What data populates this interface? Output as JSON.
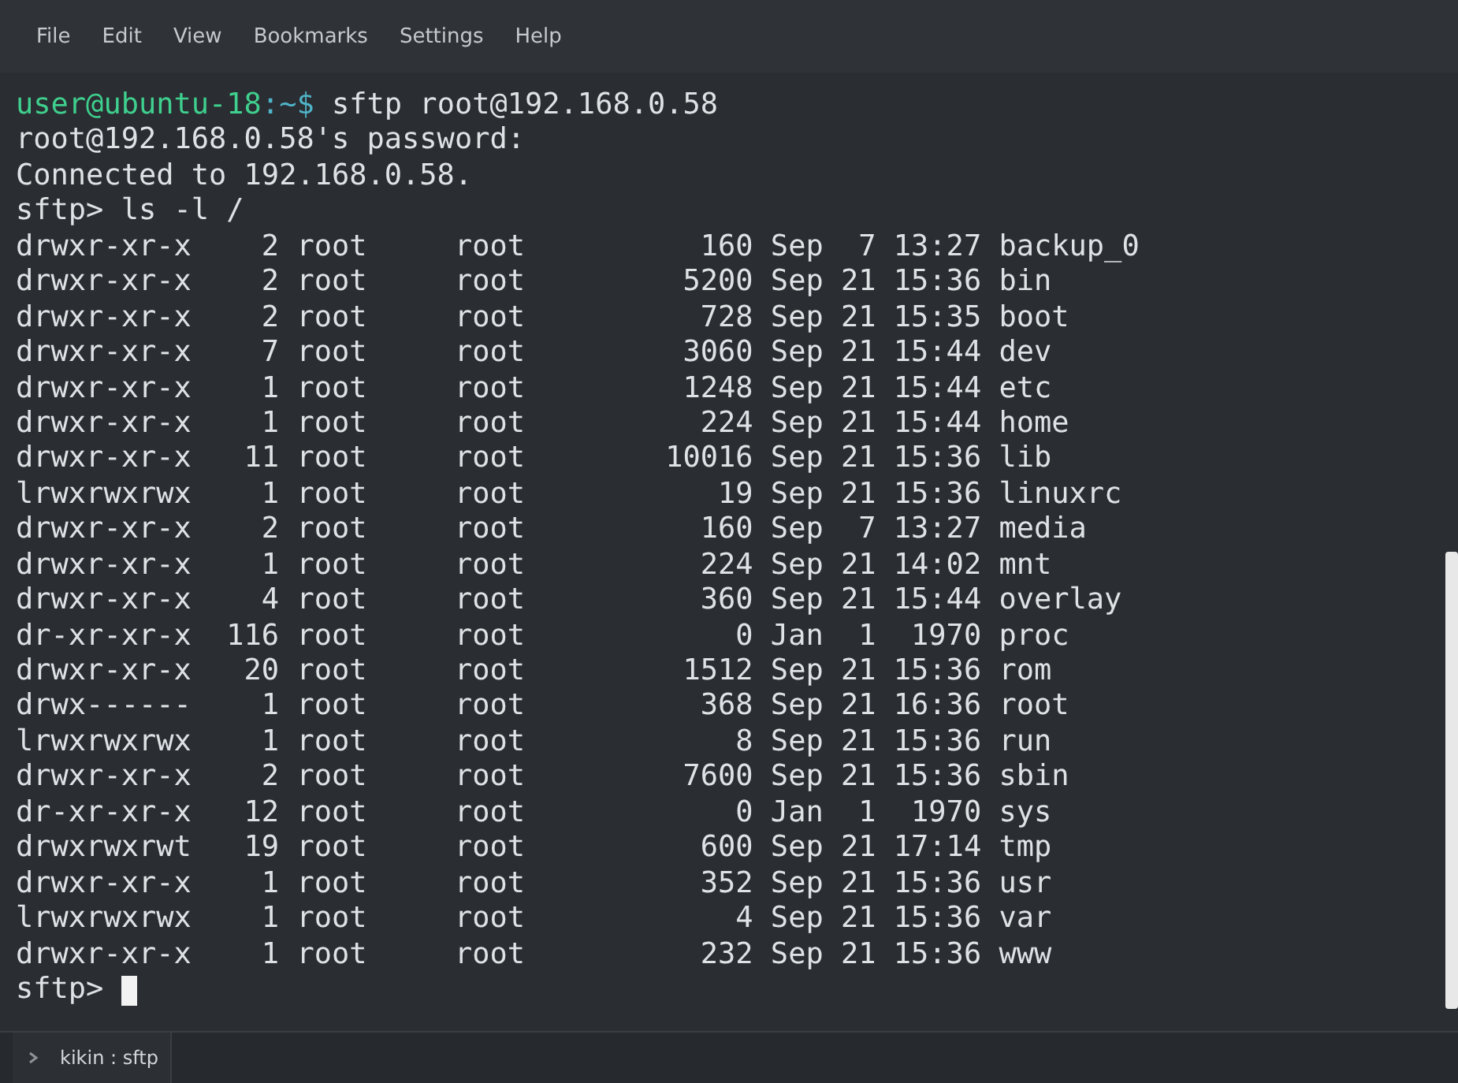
{
  "menu": [
    "File",
    "Edit",
    "View",
    "Bookmarks",
    "Settings",
    "Help"
  ],
  "terminal": {
    "lines": [
      {
        "kind": "prompt",
        "user_host": "user@ubuntu-18",
        "path": ":~$",
        "command": " sftp root@192.168.0.58"
      },
      {
        "kind": "text",
        "text": "root@192.168.0.58's password:"
      },
      {
        "kind": "text",
        "text": "Connected to 192.168.0.58."
      },
      {
        "kind": "text",
        "text": "sftp> ls -l /"
      },
      {
        "kind": "text",
        "text": "drwxr-xr-x    2 root     root          160 Sep  7 13:27 backup_0"
      },
      {
        "kind": "text",
        "text": "drwxr-xr-x    2 root     root         5200 Sep 21 15:36 bin"
      },
      {
        "kind": "text",
        "text": "drwxr-xr-x    2 root     root          728 Sep 21 15:35 boot"
      },
      {
        "kind": "text",
        "text": "drwxr-xr-x    7 root     root         3060 Sep 21 15:44 dev"
      },
      {
        "kind": "text",
        "text": "drwxr-xr-x    1 root     root         1248 Sep 21 15:44 etc"
      },
      {
        "kind": "text",
        "text": "drwxr-xr-x    1 root     root          224 Sep 21 15:44 home"
      },
      {
        "kind": "text",
        "text": "drwxr-xr-x   11 root     root        10016 Sep 21 15:36 lib"
      },
      {
        "kind": "text",
        "text": "lrwxrwxrwx    1 root     root           19 Sep 21 15:36 linuxrc"
      },
      {
        "kind": "text",
        "text": "drwxr-xr-x    2 root     root          160 Sep  7 13:27 media"
      },
      {
        "kind": "text",
        "text": "drwxr-xr-x    1 root     root          224 Sep 21 14:02 mnt"
      },
      {
        "kind": "text",
        "text": "drwxr-xr-x    4 root     root          360 Sep 21 15:44 overlay"
      },
      {
        "kind": "text",
        "text": "dr-xr-xr-x  116 root     root            0 Jan  1  1970 proc"
      },
      {
        "kind": "text",
        "text": "drwxr-xr-x   20 root     root         1512 Sep 21 15:36 rom"
      },
      {
        "kind": "text",
        "text": "drwx------    1 root     root          368 Sep 21 16:36 root"
      },
      {
        "kind": "text",
        "text": "lrwxrwxrwx    1 root     root            8 Sep 21 15:36 run"
      },
      {
        "kind": "text",
        "text": "drwxr-xr-x    2 root     root         7600 Sep 21 15:36 sbin"
      },
      {
        "kind": "text",
        "text": "dr-xr-xr-x   12 root     root            0 Jan  1  1970 sys"
      },
      {
        "kind": "text",
        "text": "drwxrwxrwt   19 root     root          600 Sep 21 17:14 tmp"
      },
      {
        "kind": "text",
        "text": "drwxr-xr-x    1 root     root          352 Sep 21 15:36 usr"
      },
      {
        "kind": "text",
        "text": "lrwxrwxrwx    1 root     root            4 Sep 21 15:36 var"
      },
      {
        "kind": "text",
        "text": "drwxr-xr-x    1 root     root          232 Sep 21 15:36 www"
      },
      {
        "kind": "input",
        "text": "sftp> "
      }
    ]
  },
  "tabs": [
    {
      "label": "kikin : sftp",
      "selected": true
    }
  ]
}
